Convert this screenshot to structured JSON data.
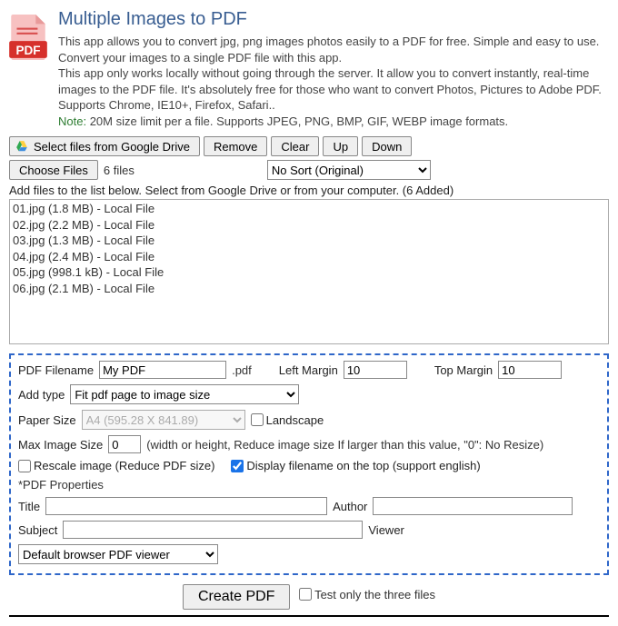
{
  "header": {
    "title": "Multiple Images to PDF",
    "desc1": "This app allows you to convert jpg, png images photos easily to a PDF for free. Simple and easy to use. Convert your images to a single PDF file with this app.",
    "desc2": "This app only works locally without going through the server. It allow you to convert instantly, real-time images to the PDF file. It's absolutely free for those who want to convert Photos, Pictures to Adobe PDF. Supports Chrome, IE10+, Firefox, Safari..",
    "note_label": "Note:",
    "note_text": "20M size limit per a file. Supports JPEG, PNG, BMP, GIF, WEBP image formats."
  },
  "buttons": {
    "gdrive": "Select files from Google Drive",
    "remove": "Remove",
    "clear": "Clear",
    "up": "Up",
    "down": "Down",
    "choose": "Choose Files",
    "create": "Create PDF"
  },
  "file_count_text": "6 files",
  "sort_selected": "No Sort (Original)",
  "addfiles_text": "Add files to the list below. Select from Google Drive or from your computer. (6 Added)",
  "files": [
    "01.jpg (1.8 MB) - Local File",
    "02.jpg (2.2 MB) - Local File",
    "03.jpg (1.3 MB) - Local File",
    "04.jpg (2.4 MB) - Local File",
    "05.jpg (998.1 kB) - Local File",
    "06.jpg (2.1 MB) - Local File"
  ],
  "settings": {
    "labels": {
      "pdf_filename": "PDF Filename",
      "pdf_ext": ".pdf",
      "left_margin": "Left Margin",
      "top_margin": "Top Margin",
      "add_type": "Add type",
      "paper_size": "Paper Size",
      "landscape": "Landscape",
      "max_img": "Max Image Size",
      "max_img_hint": "(width or height, Reduce image size If larger than this value, \"0\": No Resize)",
      "rescale": "Rescale image (Reduce PDF size)",
      "display_fn": "Display filename on the top (support english)",
      "pdf_props": "*PDF Properties",
      "title": "Title",
      "author": "Author",
      "subject": "Subject",
      "viewer": "Viewer",
      "test_only": "Test only the three files"
    },
    "values": {
      "pdf_filename": "My PDF",
      "left_margin": "10",
      "top_margin": "10",
      "add_type": "Fit pdf page to image size",
      "paper_size": "A4 (595.28 X 841.89)",
      "max_img": "0",
      "title": "",
      "author": "",
      "subject": "",
      "viewer": "Default browser PDF viewer"
    },
    "checks": {
      "landscape": false,
      "rescale": false,
      "display_fn": true,
      "test_only": false
    }
  }
}
